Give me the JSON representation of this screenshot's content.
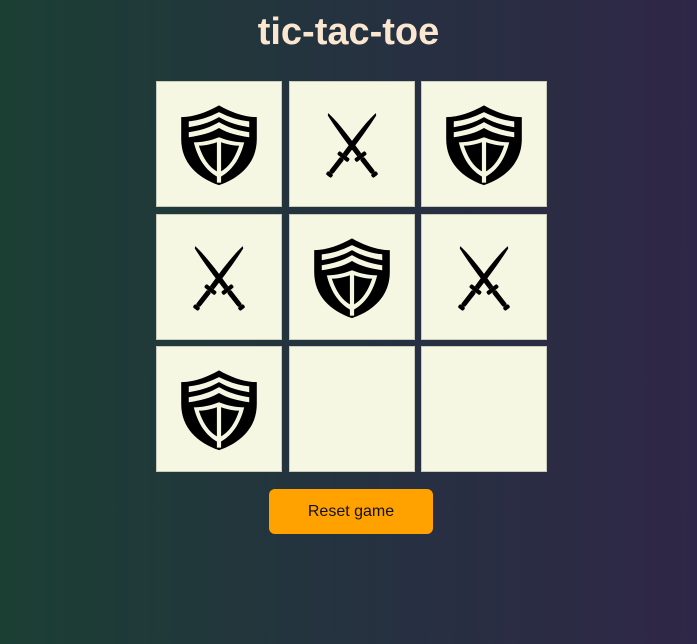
{
  "title": "tic-tac-toe",
  "board": [
    [
      "shield",
      "swords",
      "shield"
    ],
    [
      "swords",
      "shield",
      "swords"
    ],
    [
      "shield",
      "",
      ""
    ]
  ],
  "icons": {
    "shield": "shield-icon",
    "swords": "crossed-swords-icon"
  },
  "reset_label": "Reset game",
  "colors": {
    "title": "#fbe7d0",
    "cell_background": "#f6f7e3",
    "button_background": "#ffa200",
    "icon": "#000000"
  }
}
